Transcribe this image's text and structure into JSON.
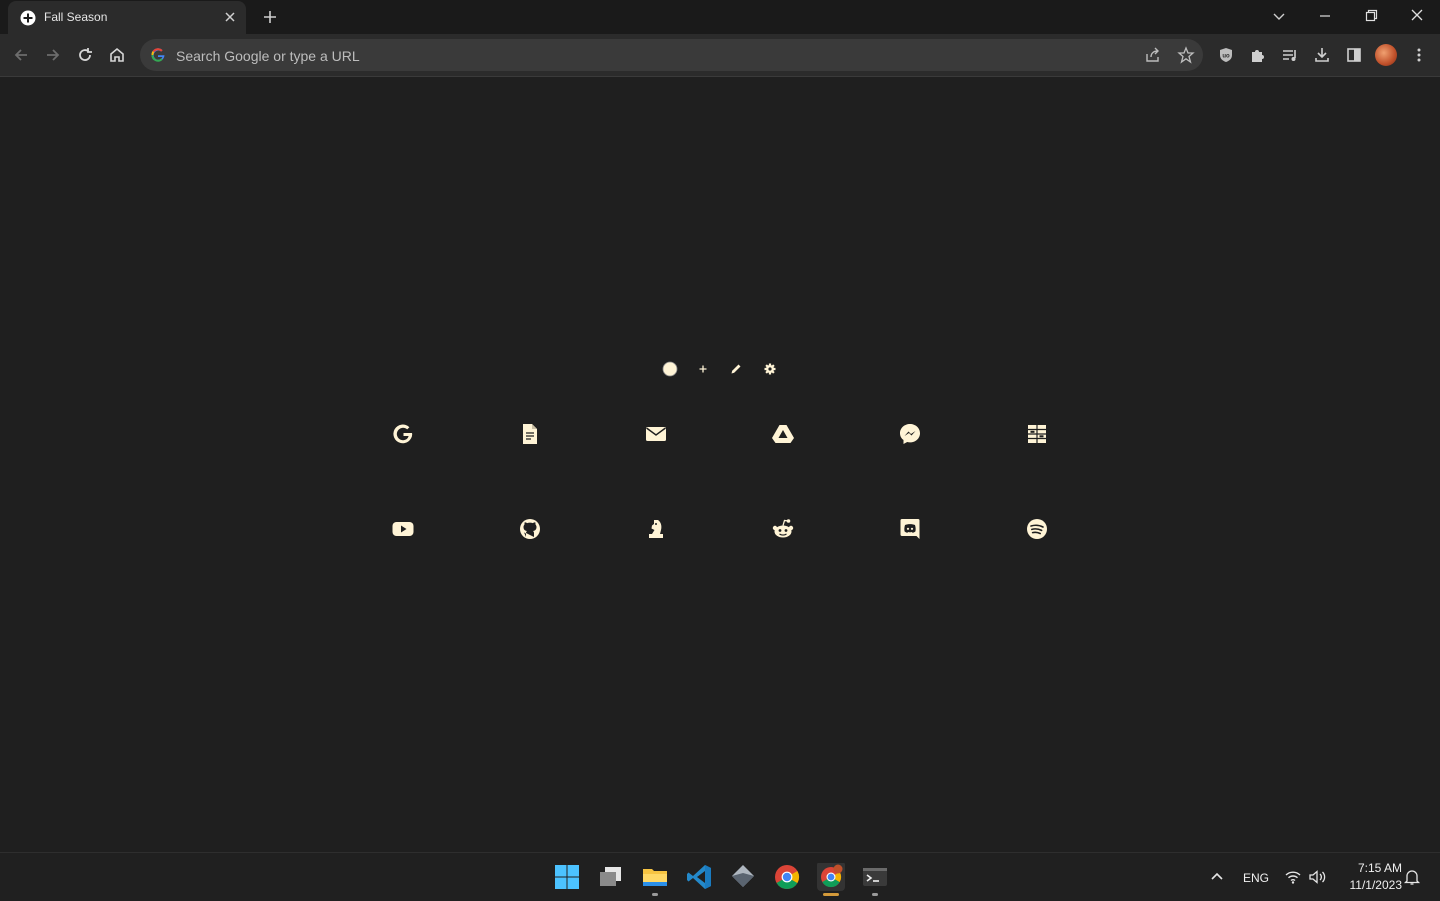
{
  "browser": {
    "tab": {
      "title": "Fall Season",
      "favicon": "plus-circle-icon"
    },
    "omnibox": {
      "placeholder": "Search Google or type a URL"
    }
  },
  "newtab": {
    "controls": [
      "theme-circle-icon",
      "add-icon",
      "edit-icon",
      "settings-icon"
    ],
    "shortcuts": [
      "google-icon",
      "docs-icon",
      "mail-icon",
      "drive-icon",
      "messenger-icon",
      "translate-icon",
      "youtube-icon",
      "github-icon",
      "chess-icon",
      "reddit-icon",
      "discord-icon",
      "spotify-icon"
    ],
    "accent": "#fff4d6"
  },
  "taskbar": {
    "apps": [
      "windows-start-icon",
      "task-view-icon",
      "file-explorer-icon",
      "vscode-icon",
      "app-icon",
      "chrome-icon",
      "chrome-profile-icon",
      "terminal-icon"
    ],
    "tray": {
      "language": "ENG",
      "time": "7:15 AM",
      "date": "11/1/2023"
    }
  }
}
